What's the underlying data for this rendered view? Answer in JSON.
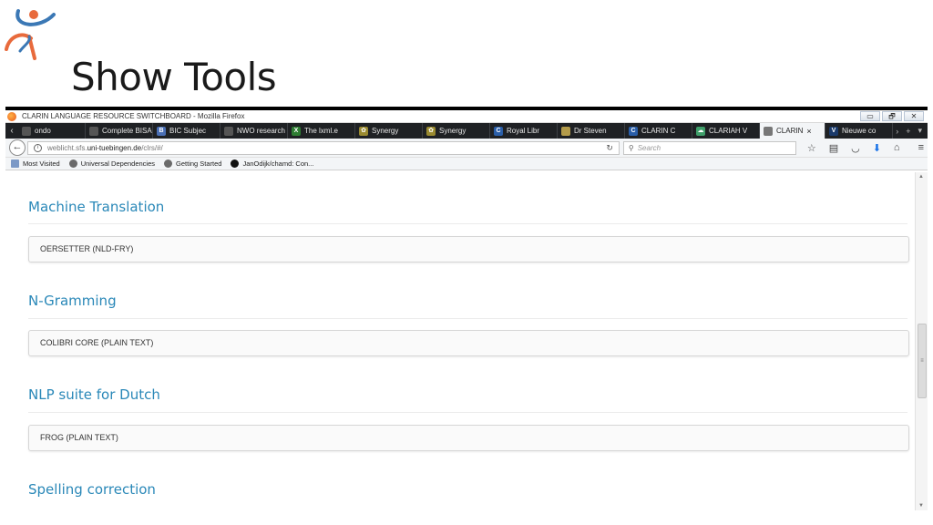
{
  "slide": {
    "title": "Show Tools"
  },
  "browser": {
    "window_title": "CLARIN LANGUAGE RESOURCE SWITCHBOARD - Mozilla Firefox",
    "window_buttons": [
      "▭",
      "🗗",
      "✕"
    ],
    "tabs": [
      {
        "label": "ondo",
        "icon": "page-icon",
        "color": "#555555"
      },
      {
        "label": "Complete BISA",
        "icon": "page-icon",
        "color": "#555555"
      },
      {
        "label": "BIC Subjec",
        "icon": "bic-icon",
        "color": "#4a6fb5"
      },
      {
        "label": "NWO research",
        "icon": "page-icon",
        "color": "#555555"
      },
      {
        "label": "The lxml.e",
        "icon": "x-icon",
        "color": "#2e7d32"
      },
      {
        "label": "Synergy",
        "icon": "synergy-icon",
        "color": "#9a8a30"
      },
      {
        "label": "Synergy",
        "icon": "synergy-icon",
        "color": "#9a8a30"
      },
      {
        "label": "Royal Libr",
        "icon": "c-icon",
        "color": "#2a5ea8"
      },
      {
        "label": "Dr Steven",
        "icon": "page-icon",
        "color": "#b39b4a"
      },
      {
        "label": "CLARIN C",
        "icon": "c-icon",
        "color": "#2a5ea8"
      },
      {
        "label": "CLARIAH V",
        "icon": "cloud-icon",
        "color": "#3f9f6a"
      },
      {
        "label": "CLARIN",
        "icon": "page-icon",
        "color": "#777777",
        "active": true
      },
      {
        "label": "Nieuwe co",
        "icon": "v-icon",
        "color": "#1b3a6b"
      }
    ],
    "url": {
      "prefix": "weblicht.sfs.",
      "host": "uni-tuebingen.de",
      "path": "/clrs/#/"
    },
    "search_placeholder": "Search",
    "bookmarks": [
      {
        "label": "Most Visited",
        "icon": "bookmark-folder-icon"
      },
      {
        "label": "Universal Dependencies",
        "icon": "globe-icon"
      },
      {
        "label": "Getting Started",
        "icon": "globe-icon"
      },
      {
        "label": "JanOdijk/chamd: Con...",
        "icon": "github-icon"
      }
    ]
  },
  "sections": [
    {
      "title": "Machine Translation",
      "tool": "OERSETTER (NLD-FRY)"
    },
    {
      "title": "N-Gramming",
      "tool": "COLIBRI CORE (PLAIN TEXT)"
    },
    {
      "title": "NLP suite for Dutch",
      "tool": "FROG (PLAIN TEXT)"
    },
    {
      "title": "Spelling correction",
      "tool": ""
    }
  ],
  "colors": {
    "accent": "#2a88b8",
    "logo_orange": "#e86a3c",
    "logo_blue": "#3b78b5",
    "tabstrip": "#1f2124"
  }
}
